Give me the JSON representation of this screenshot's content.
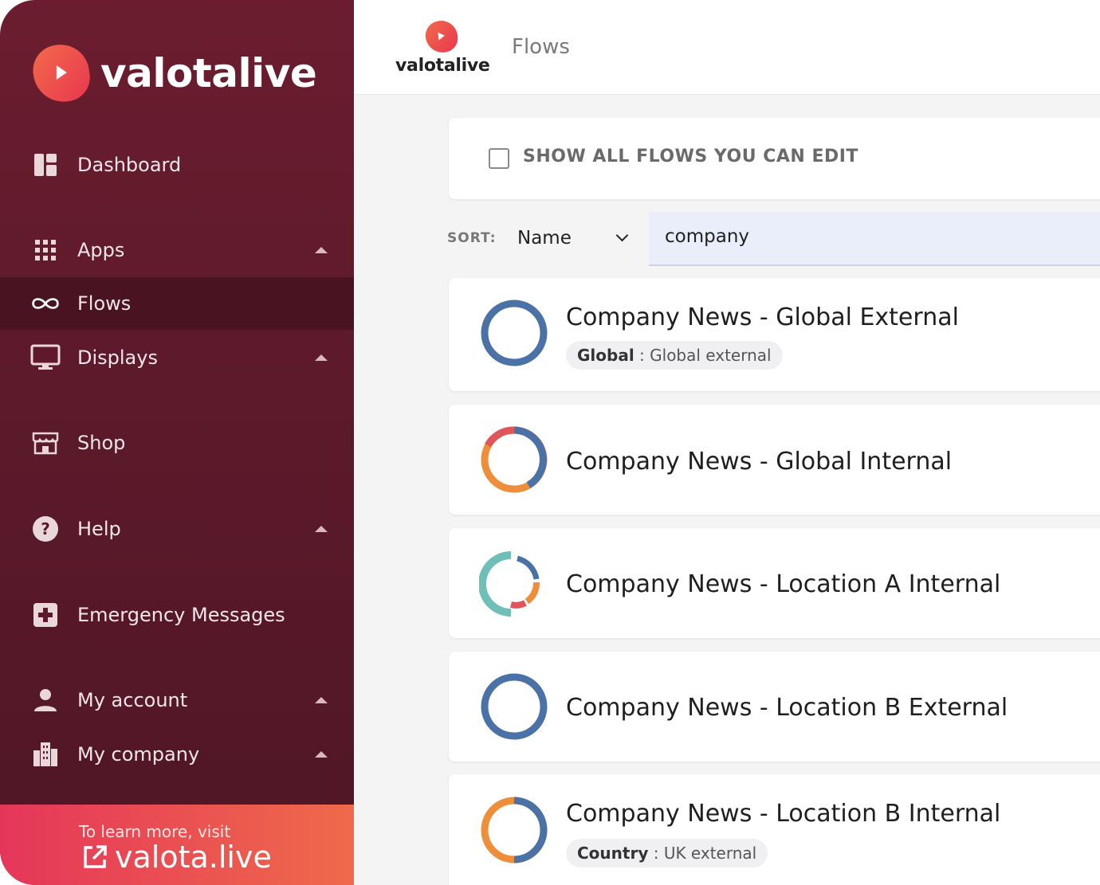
{
  "brand": {
    "name": "valotalive"
  },
  "sidebar": {
    "items": [
      {
        "label": "Dashboard",
        "icon": "dashboard-icon"
      },
      {
        "label": "Apps",
        "icon": "apps-grid-icon",
        "expandable": true
      },
      {
        "label": "Flows",
        "icon": "infinity-icon",
        "active": true
      },
      {
        "label": "Displays",
        "icon": "monitor-icon",
        "expandable": true
      },
      {
        "label": "Shop",
        "icon": "shop-icon"
      },
      {
        "label": "Help",
        "icon": "help-icon",
        "expandable": true
      },
      {
        "label": "Emergency Messages",
        "icon": "emergency-icon"
      },
      {
        "label": "My account",
        "icon": "person-icon",
        "expandable": true
      },
      {
        "label": "My company",
        "icon": "building-icon",
        "expandable": true
      }
    ],
    "footer": {
      "small": "To learn more, visit",
      "link": "valota.live"
    }
  },
  "header": {
    "title": "Flows"
  },
  "filter": {
    "checkbox_label": "SHOW ALL FLOWS YOU CAN EDIT",
    "checked": false
  },
  "sort": {
    "label": "SORT:",
    "value": "Name"
  },
  "search": {
    "value": "company"
  },
  "flows": [
    {
      "name": "Company News - Global External",
      "tag_key": "Global",
      "tag_value": "Global external"
    },
    {
      "name": "Company News - Global Internal"
    },
    {
      "name": "Company News - Location A Internal"
    },
    {
      "name": "Company News - Location B External"
    },
    {
      "name": "Company News - Location B Internal",
      "tag_key": "Country",
      "tag_value": "UK external"
    }
  ],
  "colors": {
    "accent": "#e8374f",
    "sidebar": "#5c1a2b",
    "ring_blue": "#4a72a6",
    "ring_orange": "#ee8e3a",
    "ring_red": "#e0555c",
    "ring_teal": "#6fbfb8"
  }
}
